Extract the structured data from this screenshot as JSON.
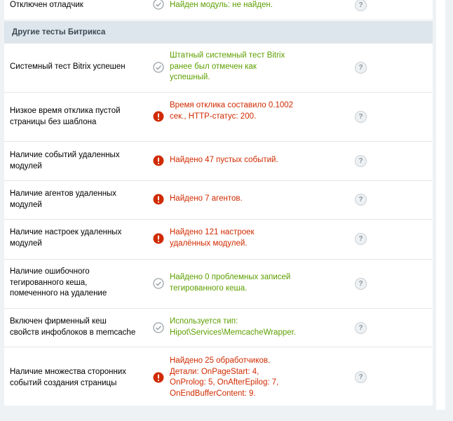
{
  "colors": {
    "ok": "#5d9f00",
    "error": "#d02a00",
    "section_bg": "#dde6ec"
  },
  "help_label": "?",
  "top_row": {
    "name": "Отключен отладчик",
    "result": "Найден модуль: не найден.",
    "status": "ok"
  },
  "section": {
    "title": "Другие тесты Битрикса"
  },
  "rows": [
    {
      "name": "Системный тест Bitrix успешен",
      "result": "Штатный системный тест Bitrix ранее был отмечен как успешный.",
      "status": "ok"
    },
    {
      "name": "Низкое время отклика пустой страницы без шаблона",
      "result": "Время отклика составило 0.1002 сек., HTTP-статус: 200.",
      "status": "error"
    },
    {
      "name": "Наличие событий удаленных модулей",
      "result": "Найдено 47 пустых событий.",
      "status": "error"
    },
    {
      "name": "Наличие агентов удаленных модулей",
      "result": "Найдено 7 агентов.",
      "status": "error"
    },
    {
      "name": "Наличие настроек удаленных модулей",
      "result": "Найдено 121 настроек удалённых модулей.",
      "status": "error"
    },
    {
      "name": "Наличие ошибочного тегированного кеша, помеченного на удаление",
      "result": "Найдено 0 проблемных записей тегированного кеша.",
      "status": "ok"
    },
    {
      "name": "Включен фирменный кеш свойств инфоблоков в memcache",
      "result": "Используется тип: Hipot\\Services\\MemcacheWrapper.",
      "status": "ok"
    },
    {
      "name": "Наличие множества сторонних событий создания страницы",
      "result": "Найдено 25 обработчиков. Детали: OnPageStart: 4, OnProlog: 5, OnAfterEpilog: 7, OnEndBufferContent: 9.",
      "status": "error"
    }
  ]
}
